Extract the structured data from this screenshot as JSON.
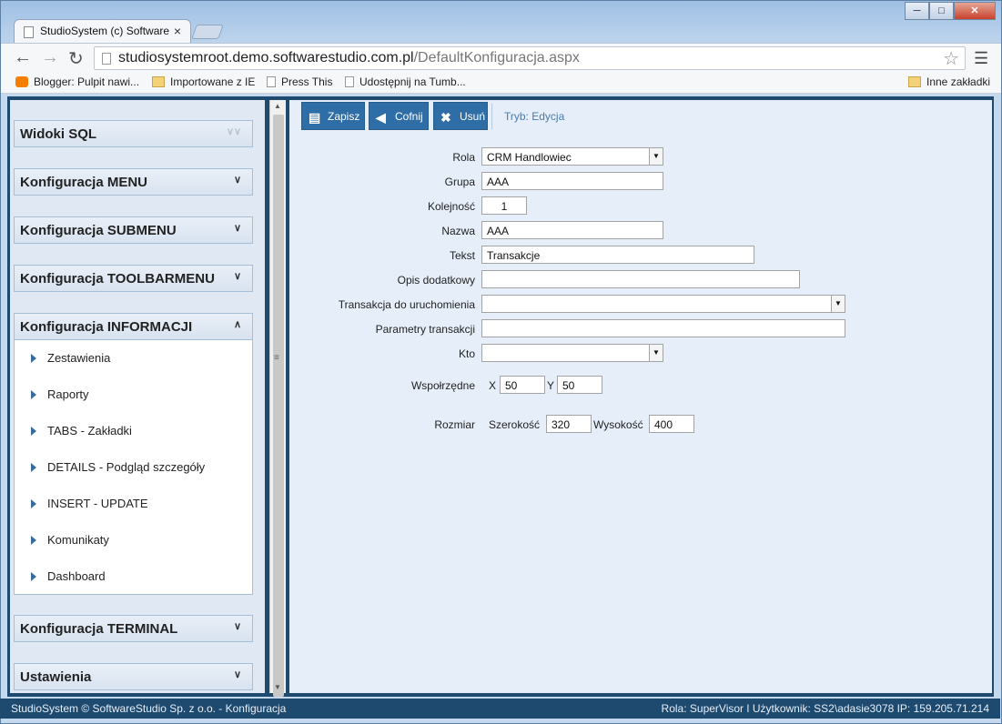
{
  "browser": {
    "tab_title": "StudioSystem (c) Software",
    "url_host": "studiosystemroot.demo.softwarestudio.com.pl",
    "url_path": "/DefaultKonfiguracja.aspx",
    "bookmarks": [
      "Blogger: Pulpit nawi...",
      "Importowane z IE",
      "Press This",
      "Udostępnij na Tumb..."
    ],
    "other_bookmarks": "Inne zakładki"
  },
  "sidebar": {
    "sections": [
      {
        "label": "Widoki SQL"
      },
      {
        "label": "Konfiguracja MENU"
      },
      {
        "label": "Konfiguracja SUBMENU"
      },
      {
        "label": "Konfiguracja TOOLBARMENU"
      },
      {
        "label": "Konfiguracja INFORMACJI"
      },
      {
        "label": "Konfiguracja TERMINAL"
      },
      {
        "label": "Ustawienia"
      }
    ],
    "items": [
      "Zestawienia",
      "Raporty",
      "TABS - Zakładki",
      "DETAILS - Podgląd szczegóły",
      "INSERT - UPDATE",
      "Komunikaty",
      "Dashboard"
    ]
  },
  "toolbar": {
    "save_label": "Zapisz",
    "undo_label": "Cofnij",
    "delete_label": "Usuń",
    "mode_label": "Tryb: Edycja"
  },
  "form": {
    "rola": {
      "label": "Rola",
      "value": "CRM Handlowiec"
    },
    "grupa": {
      "label": "Grupa",
      "value": "AAA"
    },
    "kolejnosc": {
      "label": "Kolejność",
      "value": "1"
    },
    "nazwa": {
      "label": "Nazwa",
      "value": "AAA"
    },
    "tekst": {
      "label": "Tekst",
      "value": "Transakcje"
    },
    "opis": {
      "label": "Opis dodatkowy",
      "value": ""
    },
    "transakcja": {
      "label": "Transakcja do uruchomienia",
      "value": ""
    },
    "parametry": {
      "label": "Parametry transakcji",
      "value": ""
    },
    "kto": {
      "label": "Kto",
      "value": ""
    },
    "wspolrzedne": {
      "label": "Wspołrzędne",
      "x_label": "X",
      "x_value": "50",
      "y_label": "Y",
      "y_value": "50"
    },
    "rozmiar": {
      "label": "Rozmiar",
      "w_label": "Szerokość",
      "w_value": "320",
      "h_label": "Wysokość",
      "h_value": "400"
    }
  },
  "status": {
    "left": "StudioSystem © SoftwareStudio Sp. z o.o. - Konfiguracja",
    "right": "Rola: SuperVisor ǀ Użytkownik: SS2\\adasie3078 IP: 159.205.71.214"
  }
}
